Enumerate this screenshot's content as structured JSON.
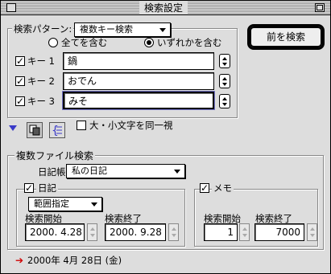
{
  "window": {
    "title": "検索設定"
  },
  "search_pattern": {
    "label": "検索パターン:",
    "value": "複数キー検索"
  },
  "prev_search_button": "前を検索",
  "match": {
    "all": "全てを含む",
    "any": "いずれかを含む"
  },
  "keys": [
    {
      "label": "キー 1",
      "value": "鍋"
    },
    {
      "label": "キー 2",
      "value": "おでん"
    },
    {
      "label": "キー 3",
      "value": "みそ"
    }
  ],
  "case_option": "大・小文字を同一視",
  "multi_file": {
    "label": "複数ファイル検索",
    "diary_book_label": "日記帳:",
    "diary_book_value": "私の日記",
    "diary": {
      "label": "日記",
      "range_value": "範囲指定",
      "start_label": "検索開始",
      "end_label": "検索終了",
      "start_value": "2000. 4.28",
      "end_value": "2000. 9.28"
    },
    "memo": {
      "label": "メモ",
      "start_label": "検索開始",
      "end_label": "検索終了",
      "start_value": "1",
      "end_value": "7000"
    }
  },
  "footer_date": "2000年 4月 28日 (金)",
  "colors": {
    "arrow": "#d00000",
    "accent": "#3a3ac8"
  }
}
